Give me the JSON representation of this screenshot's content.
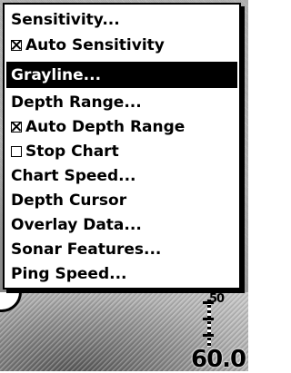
{
  "menu": {
    "items": [
      {
        "label": "Sensitivity...",
        "checkbox": null,
        "selected": false
      },
      {
        "label": "Auto Sensitivity",
        "checkbox": true,
        "selected": false
      },
      {
        "label": "Grayline...",
        "checkbox": null,
        "selected": true
      },
      {
        "label": "Depth Range...",
        "checkbox": null,
        "selected": false
      },
      {
        "label": "Auto Depth Range",
        "checkbox": true,
        "selected": false
      },
      {
        "label": "Stop Chart",
        "checkbox": false,
        "selected": false
      },
      {
        "label": "Chart Speed...",
        "checkbox": null,
        "selected": false
      },
      {
        "label": "Depth Cursor",
        "checkbox": null,
        "selected": false
      },
      {
        "label": "Overlay Data...",
        "checkbox": null,
        "selected": false
      },
      {
        "label": "Sonar Features...",
        "checkbox": null,
        "selected": false
      },
      {
        "label": "Ping Speed...",
        "checkbox": null,
        "selected": false
      }
    ]
  },
  "sonar": {
    "scale_top_label": "50",
    "depth_readout": "60.0"
  }
}
